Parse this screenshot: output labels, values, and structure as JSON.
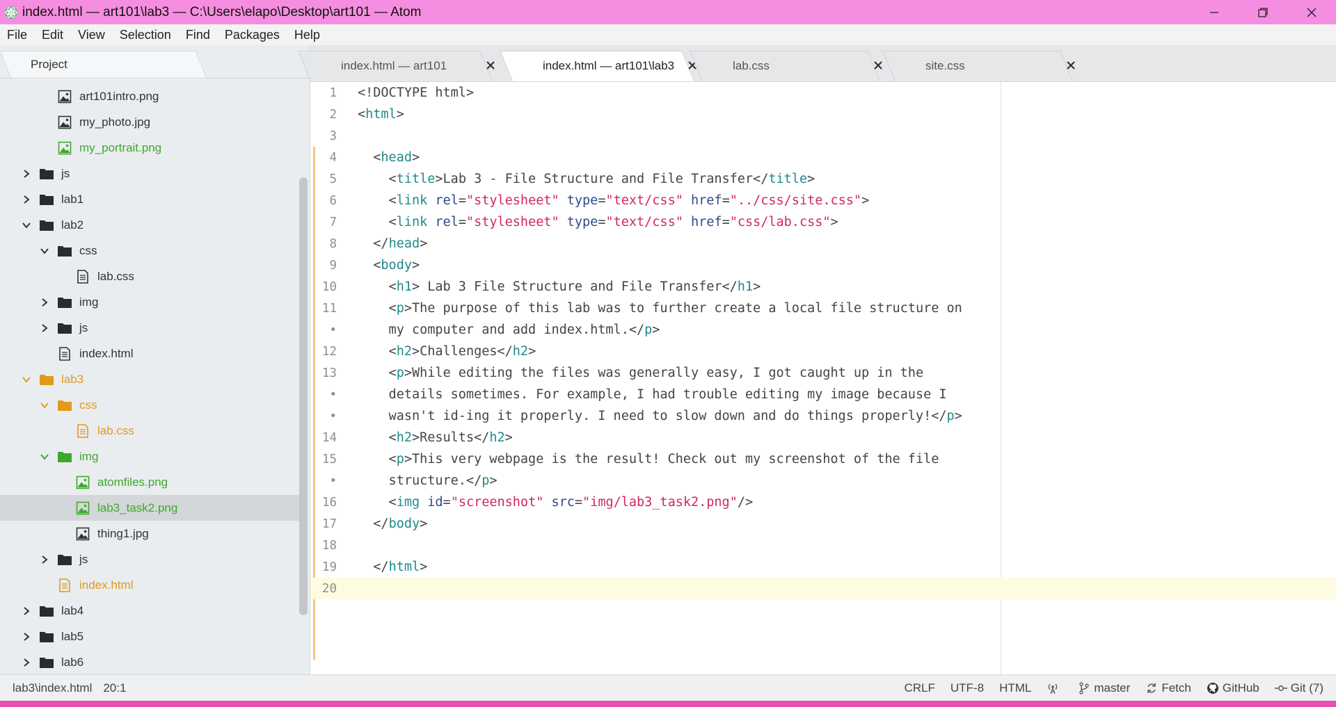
{
  "window": {
    "title": "index.html — art101\\lab3 — C:\\Users\\elapo\\Desktop\\art101 — Atom",
    "accent": "#f58ee0"
  },
  "menu": [
    "File",
    "Edit",
    "View",
    "Selection",
    "Find",
    "Packages",
    "Help"
  ],
  "tree": {
    "project_label": "Project",
    "items": [
      {
        "label": "art101intro.png",
        "kind": "image",
        "depth": 2,
        "expanded": null,
        "status": "none"
      },
      {
        "label": "my_photo.jpg",
        "kind": "image",
        "depth": 2,
        "expanded": null,
        "status": "none"
      },
      {
        "label": "my_portrait.png",
        "kind": "image",
        "depth": 2,
        "expanded": null,
        "status": "added"
      },
      {
        "label": "js",
        "kind": "folder",
        "depth": 1,
        "expanded": false,
        "status": "none"
      },
      {
        "label": "lab1",
        "kind": "folder",
        "depth": 1,
        "expanded": false,
        "status": "none"
      },
      {
        "label": "lab2",
        "kind": "folder",
        "depth": 1,
        "expanded": true,
        "status": "none"
      },
      {
        "label": "css",
        "kind": "folder",
        "depth": 2,
        "expanded": true,
        "status": "none"
      },
      {
        "label": "lab.css",
        "kind": "file",
        "depth": 3,
        "expanded": null,
        "status": "none"
      },
      {
        "label": "img",
        "kind": "folder",
        "depth": 2,
        "expanded": false,
        "status": "none"
      },
      {
        "label": "js",
        "kind": "folder",
        "depth": 2,
        "expanded": false,
        "status": "none"
      },
      {
        "label": "index.html",
        "kind": "file",
        "depth": 2,
        "expanded": null,
        "status": "none"
      },
      {
        "label": "lab3",
        "kind": "folder",
        "depth": 1,
        "expanded": true,
        "status": "modified"
      },
      {
        "label": "css",
        "kind": "folder",
        "depth": 2,
        "expanded": true,
        "status": "modified"
      },
      {
        "label": "lab.css",
        "kind": "file",
        "depth": 3,
        "expanded": null,
        "status": "modified"
      },
      {
        "label": "img",
        "kind": "folder",
        "depth": 2,
        "expanded": true,
        "status": "added"
      },
      {
        "label": "atomfiles.png",
        "kind": "image",
        "depth": 3,
        "expanded": null,
        "status": "added"
      },
      {
        "label": "lab3_task2.png",
        "kind": "image",
        "depth": 3,
        "expanded": null,
        "status": "added",
        "selected": true
      },
      {
        "label": "thing1.jpg",
        "kind": "image",
        "depth": 3,
        "expanded": null,
        "status": "none"
      },
      {
        "label": "js",
        "kind": "folder",
        "depth": 2,
        "expanded": false,
        "status": "none"
      },
      {
        "label": "index.html",
        "kind": "file",
        "depth": 2,
        "expanded": null,
        "status": "modified"
      },
      {
        "label": "lab4",
        "kind": "folder",
        "depth": 1,
        "expanded": false,
        "status": "none"
      },
      {
        "label": "lab5",
        "kind": "folder",
        "depth": 1,
        "expanded": false,
        "status": "none"
      },
      {
        "label": "lab6",
        "kind": "folder",
        "depth": 1,
        "expanded": false,
        "status": "none"
      }
    ]
  },
  "tabs": [
    {
      "label": "index.html — art101",
      "active": false
    },
    {
      "label": "index.html — art101\\lab3",
      "active": true
    },
    {
      "label": "lab.css",
      "active": false
    },
    {
      "label": "site.css",
      "active": false
    }
  ],
  "editor": {
    "lines": [
      {
        "n": "1",
        "segs": [
          [
            "t",
            "<!DOCTYPE html>"
          ]
        ]
      },
      {
        "n": "2",
        "segs": [
          [
            "t",
            "<"
          ],
          [
            "tag",
            "html"
          ],
          [
            "t",
            ">"
          ]
        ]
      },
      {
        "n": "3",
        "segs": []
      },
      {
        "n": "4",
        "segs": [
          [
            "t",
            "  <"
          ],
          [
            "tag",
            "head"
          ],
          [
            "t",
            ">"
          ]
        ]
      },
      {
        "n": "5",
        "segs": [
          [
            "t",
            "    <"
          ],
          [
            "tag",
            "title"
          ],
          [
            "t",
            ">Lab 3 - File Structure and File Transfer</"
          ],
          [
            "tag",
            "title"
          ],
          [
            "t",
            ">"
          ]
        ]
      },
      {
        "n": "6",
        "segs": [
          [
            "t",
            "    <"
          ],
          [
            "tag",
            "link"
          ],
          [
            "t",
            " "
          ],
          [
            "attr",
            "rel"
          ],
          [
            "t",
            "="
          ],
          [
            "str",
            "\"stylesheet\""
          ],
          [
            "t",
            " "
          ],
          [
            "attr",
            "type"
          ],
          [
            "t",
            "="
          ],
          [
            "str",
            "\"text/css\""
          ],
          [
            "t",
            " "
          ],
          [
            "attr",
            "href"
          ],
          [
            "t",
            "="
          ],
          [
            "str",
            "\"../css/site.css\""
          ],
          [
            "t",
            ">"
          ]
        ]
      },
      {
        "n": "7",
        "segs": [
          [
            "t",
            "    <"
          ],
          [
            "tag",
            "link"
          ],
          [
            "t",
            " "
          ],
          [
            "attr",
            "rel"
          ],
          [
            "t",
            "="
          ],
          [
            "str",
            "\"stylesheet\""
          ],
          [
            "t",
            " "
          ],
          [
            "attr",
            "type"
          ],
          [
            "t",
            "="
          ],
          [
            "str",
            "\"text/css\""
          ],
          [
            "t",
            " "
          ],
          [
            "attr",
            "href"
          ],
          [
            "t",
            "="
          ],
          [
            "str",
            "\"css/lab.css\""
          ],
          [
            "t",
            ">"
          ]
        ]
      },
      {
        "n": "8",
        "segs": [
          [
            "t",
            "  </"
          ],
          [
            "tag",
            "head"
          ],
          [
            "t",
            ">"
          ]
        ]
      },
      {
        "n": "9",
        "segs": [
          [
            "t",
            "  <"
          ],
          [
            "tag",
            "body"
          ],
          [
            "t",
            ">"
          ]
        ]
      },
      {
        "n": "10",
        "segs": [
          [
            "t",
            "    <"
          ],
          [
            "tag",
            "h1"
          ],
          [
            "t",
            "> Lab 3 File Structure and File Transfer</"
          ],
          [
            "tag",
            "h1"
          ],
          [
            "t",
            ">"
          ]
        ]
      },
      {
        "n": "11",
        "segs": [
          [
            "t",
            "    <"
          ],
          [
            "tag",
            "p"
          ],
          [
            "t",
            ">The purpose of this lab was to further create a local file structure on"
          ]
        ]
      },
      {
        "n": "•",
        "segs": [
          [
            "t",
            "    my computer and add index.html.</"
          ],
          [
            "tag",
            "p"
          ],
          [
            "t",
            ">"
          ]
        ]
      },
      {
        "n": "12",
        "segs": [
          [
            "t",
            "    <"
          ],
          [
            "tag",
            "h2"
          ],
          [
            "t",
            ">Challenges</"
          ],
          [
            "tag",
            "h2"
          ],
          [
            "t",
            ">"
          ]
        ]
      },
      {
        "n": "13",
        "segs": [
          [
            "t",
            "    <"
          ],
          [
            "tag",
            "p"
          ],
          [
            "t",
            ">While editing the files was generally easy, I got caught up in the"
          ]
        ]
      },
      {
        "n": "•",
        "segs": [
          [
            "t",
            "    details sometimes. For example, I had trouble editing my image because I"
          ]
        ]
      },
      {
        "n": "•",
        "segs": [
          [
            "t",
            "    wasn't id-ing it properly. I need to slow down and do things properly!</"
          ],
          [
            "tag",
            "p"
          ],
          [
            "t",
            ">"
          ]
        ]
      },
      {
        "n": "14",
        "segs": [
          [
            "t",
            "    <"
          ],
          [
            "tag",
            "h2"
          ],
          [
            "t",
            ">Results</"
          ],
          [
            "tag",
            "h2"
          ],
          [
            "t",
            ">"
          ]
        ]
      },
      {
        "n": "15",
        "segs": [
          [
            "t",
            "    <"
          ],
          [
            "tag",
            "p"
          ],
          [
            "t",
            ">This very webpage is the result! Check out my screenshot of the file"
          ]
        ]
      },
      {
        "n": "•",
        "segs": [
          [
            "t",
            "    structure.</"
          ],
          [
            "tag",
            "p"
          ],
          [
            "t",
            ">"
          ]
        ]
      },
      {
        "n": "16",
        "segs": [
          [
            "t",
            "    <"
          ],
          [
            "tag",
            "img"
          ],
          [
            "t",
            " "
          ],
          [
            "attr",
            "id"
          ],
          [
            "t",
            "="
          ],
          [
            "str",
            "\"screenshot\""
          ],
          [
            "t",
            " "
          ],
          [
            "attr",
            "src"
          ],
          [
            "t",
            "="
          ],
          [
            "str",
            "\"img/lab3_task2.png\""
          ],
          [
            "t",
            "/>"
          ]
        ]
      },
      {
        "n": "17",
        "segs": [
          [
            "t",
            "  </"
          ],
          [
            "tag",
            "body"
          ],
          [
            "t",
            ">"
          ]
        ]
      },
      {
        "n": "18",
        "segs": []
      },
      {
        "n": "19",
        "segs": [
          [
            "t",
            "  </"
          ],
          [
            "tag",
            "html"
          ],
          [
            "t",
            ">"
          ]
        ]
      },
      {
        "n": "20",
        "segs": [],
        "cursor": true
      }
    ]
  },
  "status": {
    "file_path": "lab3\\index.html",
    "cursor_pos": "20:1",
    "line_ending": "CRLF",
    "encoding": "UTF-8",
    "grammar": "HTML",
    "branch": "master",
    "fetch": "Fetch",
    "github": "GitHub",
    "git": "Git (7)"
  },
  "colors": {
    "added": "#3fa82c",
    "modified": "#e29a1a",
    "bottom_strip": "#e64fb0"
  }
}
